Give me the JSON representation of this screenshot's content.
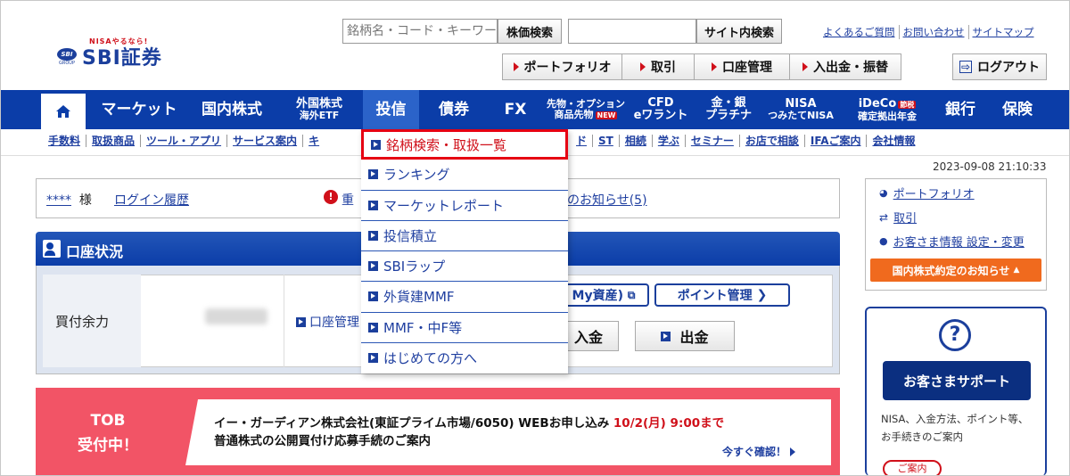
{
  "header": {
    "logo_tagline": "NISAやるなら!",
    "logo_mark": "SBI",
    "logo_text": "SBI証券",
    "logo_group": "GROUP",
    "search_placeholder": "銘柄名・コード・キーワード",
    "stock_search_label": "株価検索",
    "site_search_label": "サイト内検索",
    "top_links": [
      "よくあるご質問",
      "お問い合わせ",
      "サイトマップ"
    ],
    "nav_buttons": [
      "ポートフォリオ",
      "取引",
      "口座管理",
      "入出金・振替"
    ],
    "logout_label": "ログアウト"
  },
  "main_nav": {
    "items": [
      {
        "label": "マーケット"
      },
      {
        "label": "国内株式"
      },
      {
        "line1": "外国株式",
        "line2": "海外ETF"
      },
      {
        "label": "投信"
      },
      {
        "label": "債券"
      },
      {
        "label": "FX"
      },
      {
        "line1": "先物・オプション",
        "line2": "商品先物",
        "badge": "NEW"
      },
      {
        "line1": "CFD",
        "line2": "eワラント"
      },
      {
        "line1": "金・銀",
        "line2": "プラチナ"
      },
      {
        "line1": "NISA",
        "line2": "つみたてNISA"
      },
      {
        "line1": "iDeCo",
        "line2": "確定拠出年金",
        "badge": "節税"
      },
      {
        "label": "銀行"
      },
      {
        "label": "保険"
      }
    ]
  },
  "sub_nav": {
    "left": [
      "手数料",
      "取扱商品",
      "ツール・アプリ",
      "サービス案内",
      "キ"
    ],
    "right": [
      "ド",
      "ST",
      "相続",
      "学ぶ",
      "セミナー",
      "お店で相談",
      "IFAご案内",
      "会社情報"
    ]
  },
  "timestamp": "2023-09-08 21:10:33",
  "user_bar": {
    "user_name": "****",
    "honorific": "様",
    "login_history": "ログイン履歴",
    "warning_fragment": "重",
    "notice_fragment": "のお知らせ(5)"
  },
  "account": {
    "title": "口座状況",
    "buying_power_label": "買付余力",
    "account_link_fragment": "口座管理",
    "my_assets_fragment": "My資産)",
    "points_label": "ポイント管理",
    "deposit_fragment": "入金",
    "withdraw_label": "出金"
  },
  "tob": {
    "title_line1": "TOB",
    "title_line2": "受付中！",
    "line1": "イー・ガーディアン株式会社(東証プライム市場/6050) WEBお申し込み",
    "line1_deadline": "10/2(月) 9:00まで",
    "line2": "普通株式の公開買付け応募手続のご案内",
    "link": "今すぐ確認！"
  },
  "sidebar": {
    "items": [
      "ポートフォリオ",
      "取引",
      "お客さま情報 設定・変更"
    ],
    "orange_notice": "国内株式約定のお知らせ",
    "support_title": "お客さまサポート",
    "support_text": "NISA、入金方法、ポイント等、お手続きのご案内",
    "guide_label": "ご案内"
  },
  "dropdown": {
    "items": [
      "銘柄検索・取扱一覧",
      "ランキング",
      "マーケットレポート",
      "投信積立",
      "SBIラップ",
      "外貨建MMF",
      "MMF・中F等",
      "はじめての方へ"
    ],
    "highlighted_index": 0
  },
  "colors": {
    "brand_blue": "#0b3da8",
    "accent_red": "#d0101a",
    "tob_pink": "#f25466",
    "notice_orange": "#f06a1e"
  }
}
